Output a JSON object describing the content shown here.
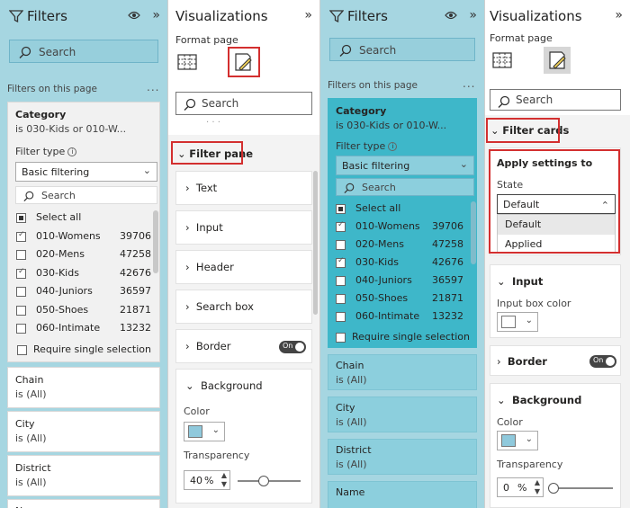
{
  "left_filters": {
    "title": "Filters",
    "search_placeholder": "Search",
    "section_label": "Filters on this page",
    "more": "...",
    "category": {
      "name": "Category",
      "value": "is 030-Kids or 010-W...",
      "filter_type_label": "Filter type",
      "filter_type_value": "Basic filtering",
      "search_placeholder": "Search",
      "items": [
        {
          "label": "Select all",
          "count": "",
          "state": "partial"
        },
        {
          "label": "010-Womens",
          "count": "39706",
          "state": "checked"
        },
        {
          "label": "020-Mens",
          "count": "47258",
          "state": "unchecked"
        },
        {
          "label": "030-Kids",
          "count": "42676",
          "state": "checked"
        },
        {
          "label": "040-Juniors",
          "count": "36597",
          "state": "unchecked"
        },
        {
          "label": "050-Shoes",
          "count": "21871",
          "state": "unchecked"
        },
        {
          "label": "060-Intimate",
          "count": "13232",
          "state": "unchecked"
        }
      ],
      "require_single": "Require single selection"
    },
    "other_filters": [
      {
        "name": "Chain",
        "value": "is (All)"
      },
      {
        "name": "City",
        "value": "is (All)"
      },
      {
        "name": "District",
        "value": "is (All)"
      },
      {
        "name": "Na"
      }
    ]
  },
  "left_viz": {
    "title": "Visualizations",
    "format_page": "Format page",
    "search_placeholder": "Search",
    "dots": ". . .",
    "filter_pane": "Filter pane",
    "cards": [
      "Text",
      "Input",
      "Header",
      "Search box"
    ],
    "border": "Border",
    "toggle_on": "On",
    "background": "Background",
    "color_label": "Color",
    "transparency_label": "Transparency",
    "transparency_value": "40",
    "transparency_unit": "%",
    "transparency_fraction": 0.4,
    "color_swatch": "#8fc9dc"
  },
  "right_filters": {
    "title": "Filters",
    "search_placeholder": "Search",
    "section_label": "Filters on this page",
    "more": "...",
    "category": {
      "name": "Category",
      "value": "is 030-Kids or 010-W...",
      "filter_type_label": "Filter type",
      "filter_type_value": "Basic filtering",
      "search_placeholder": "Search",
      "items": [
        {
          "label": "Select all",
          "count": "",
          "state": "partial"
        },
        {
          "label": "010-Womens",
          "count": "39706",
          "state": "checked"
        },
        {
          "label": "020-Mens",
          "count": "47258",
          "state": "unchecked"
        },
        {
          "label": "030-Kids",
          "count": "42676",
          "state": "checked"
        },
        {
          "label": "040-Juniors",
          "count": "36597",
          "state": "unchecked"
        },
        {
          "label": "050-Shoes",
          "count": "21871",
          "state": "unchecked"
        },
        {
          "label": "060-Intimate",
          "count": "13232",
          "state": "unchecked"
        }
      ],
      "require_single": "Require single selection"
    },
    "other_filters": [
      {
        "name": "Chain",
        "value": "is (All)"
      },
      {
        "name": "City",
        "value": "is (All)"
      },
      {
        "name": "District",
        "value": "is (All)"
      },
      {
        "name": "Name"
      }
    ]
  },
  "right_viz": {
    "title": "Visualizations",
    "format_page": "Format page",
    "search_placeholder": "Search",
    "filter_cards": "Filter cards",
    "apply_settings": "Apply settings to",
    "state_label": "State",
    "state_value": "Default",
    "state_options": [
      "Default",
      "Applied"
    ],
    "input": "Input",
    "input_box_color": "Input box color",
    "border": "Border",
    "toggle_on": "On",
    "background": "Background",
    "color_label": "Color",
    "transparency_label": "Transparency",
    "transparency_value": "0",
    "transparency_unit": "%",
    "transparency_fraction": 0,
    "color_swatch": "#8fc9dc"
  },
  "colors": {
    "filters_bg": "#a6d6e1",
    "highlight": "#d32f2f"
  }
}
